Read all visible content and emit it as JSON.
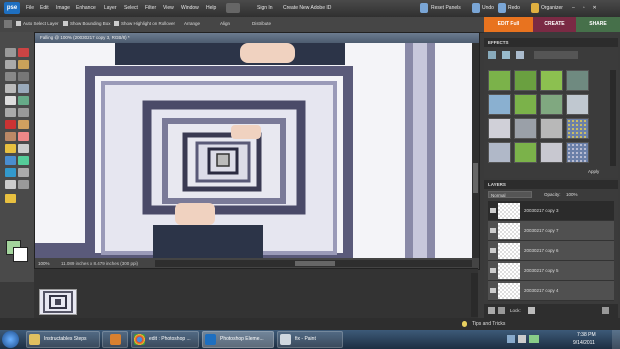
{
  "app": {
    "logo": "pse"
  },
  "menubar": {
    "items": [
      "File",
      "Edit",
      "Image",
      "Enhance",
      "Layer",
      "Select",
      "Filter",
      "View",
      "Window",
      "Help"
    ],
    "sign_in": "Sign In",
    "create_account": "Create New Adobe ID",
    "reset_panels": "Reset Panels",
    "undo": "Undo",
    "redo": "Redo",
    "organizer": "Organizer"
  },
  "options": {
    "auto_select": "Auto Select Layer",
    "bounding_box": "Show Bounding Box",
    "highlight": "Show Highlight on Rollover",
    "arrange": "Arrange",
    "align": "Align",
    "distribute": "Distribute"
  },
  "modes": {
    "edit": "EDIT Full",
    "create": "CREATE",
    "share": "SHARE"
  },
  "document": {
    "title": "Falling @ 100% (20030217 copy 3, RGB/8) *",
    "zoom": "100%",
    "dimensions": "11.089 inches x 8.479 inches (300 ppi)"
  },
  "effects": {
    "header": "EFFECTS",
    "apply": "Apply",
    "colors": {
      "green": "#7bb24a",
      "gray": "#b8b8b8",
      "dots": "#6b80a8"
    }
  },
  "layers": {
    "header": "LAYERS",
    "blend_mode": "Normal",
    "opacity_label": "Opacity:",
    "opacity": "100%",
    "lock_label": "Lock:",
    "items": [
      {
        "name": "20030217 copy 3"
      },
      {
        "name": "20030217 copy 7"
      },
      {
        "name": "20030217 copy 6"
      },
      {
        "name": "20030217 copy 5"
      },
      {
        "name": "20030217 copy 4"
      }
    ]
  },
  "bottom": {
    "tips": "Tips and Tricks"
  },
  "taskbar": {
    "items": [
      {
        "label": "Instructables Steps"
      },
      {
        "label": ""
      },
      {
        "label": "edit : Photoshop ..."
      },
      {
        "label": "Photoshop Eleme..."
      },
      {
        "label": "fix - Paint"
      }
    ],
    "time": "7:38 PM",
    "date": "9/14/2011"
  }
}
